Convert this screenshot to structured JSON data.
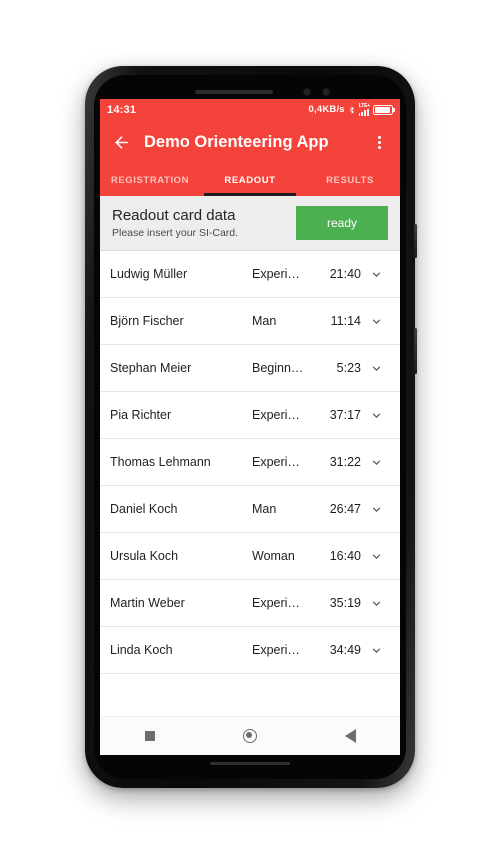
{
  "theme": {
    "brand_color": "#F4433A",
    "accent_green": "#4CAF50",
    "tab_indicator_color": "#1C1C1C",
    "card_background": "#EDEDEE"
  },
  "status_bar": {
    "time": "14:31",
    "network_speed": "0,4KB/s",
    "bluetooth_icon": "bluetooth-icon",
    "network_type": "LTE+",
    "signal_icon": "signal-bars-icon",
    "battery_icon": "battery-full-icon"
  },
  "app_bar": {
    "back_icon": "back-arrow-icon",
    "title": "Demo Orienteering App",
    "overflow_icon": "overflow-menu-icon"
  },
  "tabs": [
    {
      "label": "REGISTRATION",
      "active": false
    },
    {
      "label": "READOUT",
      "active": true
    },
    {
      "label": "RESULTS",
      "active": false
    }
  ],
  "readout_card": {
    "title": "Readout card data",
    "subtitle": "Please insert your SI-Card.",
    "status_button_label": "ready"
  },
  "results": {
    "rows": [
      {
        "name": "Ludwig Müller",
        "class": "Experi…",
        "time": "21:40",
        "expand_icon": "chevron-down-icon"
      },
      {
        "name": "Björn Fischer",
        "class": "Man",
        "time": "11:14",
        "expand_icon": "chevron-down-icon"
      },
      {
        "name": "Stephan Meier",
        "class": "Beginn…",
        "time": "5:23",
        "expand_icon": "chevron-down-icon"
      },
      {
        "name": "Pia Richter",
        "class": "Experi…",
        "time": "37:17",
        "expand_icon": "chevron-down-icon"
      },
      {
        "name": "Thomas Lehmann",
        "class": "Experi…",
        "time": "31:22",
        "expand_icon": "chevron-down-icon"
      },
      {
        "name": "Daniel Koch",
        "class": "Man",
        "time": "26:47",
        "expand_icon": "chevron-down-icon"
      },
      {
        "name": "Ursula Koch",
        "class": "Woman",
        "time": "16:40",
        "expand_icon": "chevron-down-icon"
      },
      {
        "name": "Martin Weber",
        "class": "Experi…",
        "time": "35:19",
        "expand_icon": "chevron-down-icon"
      },
      {
        "name": "Linda Koch",
        "class": "Experi…",
        "time": "34:49",
        "expand_icon": "chevron-down-icon"
      }
    ]
  },
  "nav_bar": {
    "recents_icon": "recents-square-icon",
    "home_icon": "home-circle-icon",
    "back_icon": "back-triangle-icon"
  }
}
